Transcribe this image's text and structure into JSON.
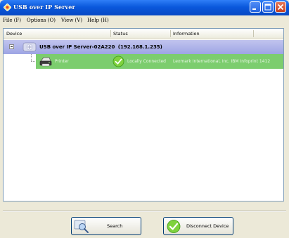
{
  "window": {
    "title": "USB over IP Server",
    "colors": {
      "titlebar": "#0a58dc",
      "server_row": "#a9b0e8",
      "device_row": "#7ccd6e"
    }
  },
  "menu": {
    "items": [
      {
        "label": "File (F)"
      },
      {
        "label": "Options (O)"
      },
      {
        "label": "View (V)"
      },
      {
        "label": "Help (H)"
      }
    ]
  },
  "list": {
    "columns": [
      "Device",
      "Status",
      "Information"
    ],
    "server": {
      "label": "USB over IP Server-02A220",
      "address": "(192.168.1.235)"
    },
    "device": {
      "name": "Printer",
      "status": "Locally Connected",
      "information": "Lexmark International, Inc. IBM Infoprint 1412"
    }
  },
  "buttons": {
    "search": "Search",
    "disconnect": "Disconnect Device"
  }
}
